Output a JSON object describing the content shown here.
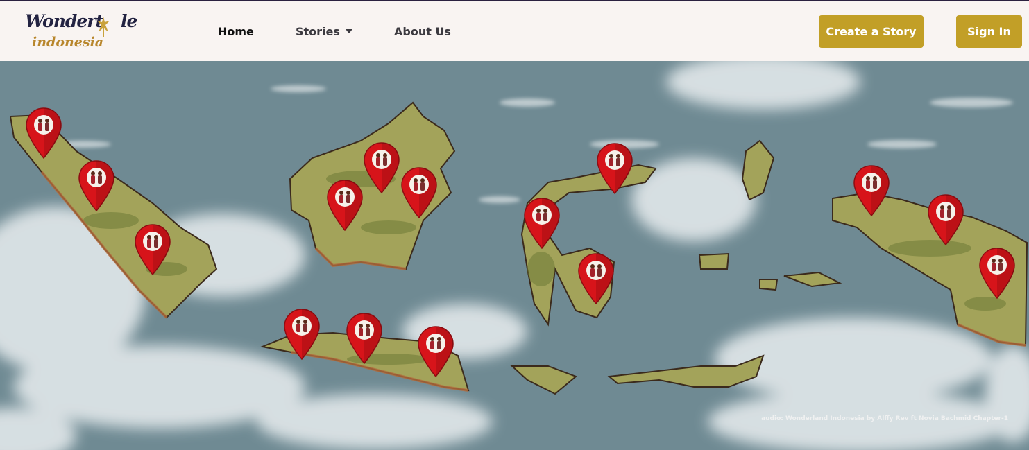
{
  "brand": {
    "logo_line1": "Wondert",
    "logo_line1_tail": "le",
    "logo_line2": "indonesia",
    "colors": {
      "navy": "#232342",
      "gold": "#b8862c"
    }
  },
  "nav": {
    "home": "Home",
    "stories": "Stories",
    "about": "About Us"
  },
  "actions": {
    "create_story": "Create a Story",
    "sign_in": "Sign In",
    "button_color": "#c29f27"
  },
  "map": {
    "pins": [
      {
        "region": "sumatra-north",
        "icon": "costume-couple-icon"
      },
      {
        "region": "sumatra-west",
        "icon": "costume-couple-icon"
      },
      {
        "region": "sumatra-south",
        "icon": "costume-couple-icon"
      },
      {
        "region": "kalimantan-west",
        "icon": "costume-couple-icon"
      },
      {
        "region": "kalimantan-north",
        "icon": "costume-couple-icon"
      },
      {
        "region": "kalimantan-east",
        "icon": "costume-couple-icon"
      },
      {
        "region": "sulawesi-north",
        "icon": "costume-couple-icon"
      },
      {
        "region": "sulawesi-central",
        "icon": "costume-couple-icon"
      },
      {
        "region": "sulawesi-south",
        "icon": "costume-couple-icon"
      },
      {
        "region": "java-west",
        "icon": "costume-couple-icon"
      },
      {
        "region": "java-central",
        "icon": "costume-couple-icon"
      },
      {
        "region": "java-east",
        "icon": "costume-couple-icon"
      },
      {
        "region": "papua-west",
        "icon": "costume-couple-icon"
      },
      {
        "region": "papua-central",
        "icon": "costume-couple-icon"
      },
      {
        "region": "papua-south",
        "icon": "costume-couple-icon"
      }
    ],
    "pin_color": "#d7141a",
    "land_color": "#a3a35a",
    "sea_color": "#6f8a93"
  },
  "audio_credit": "audio: Wonderland Indonesia by Alffy Rev ft Novia Bachmid Chapter-1"
}
